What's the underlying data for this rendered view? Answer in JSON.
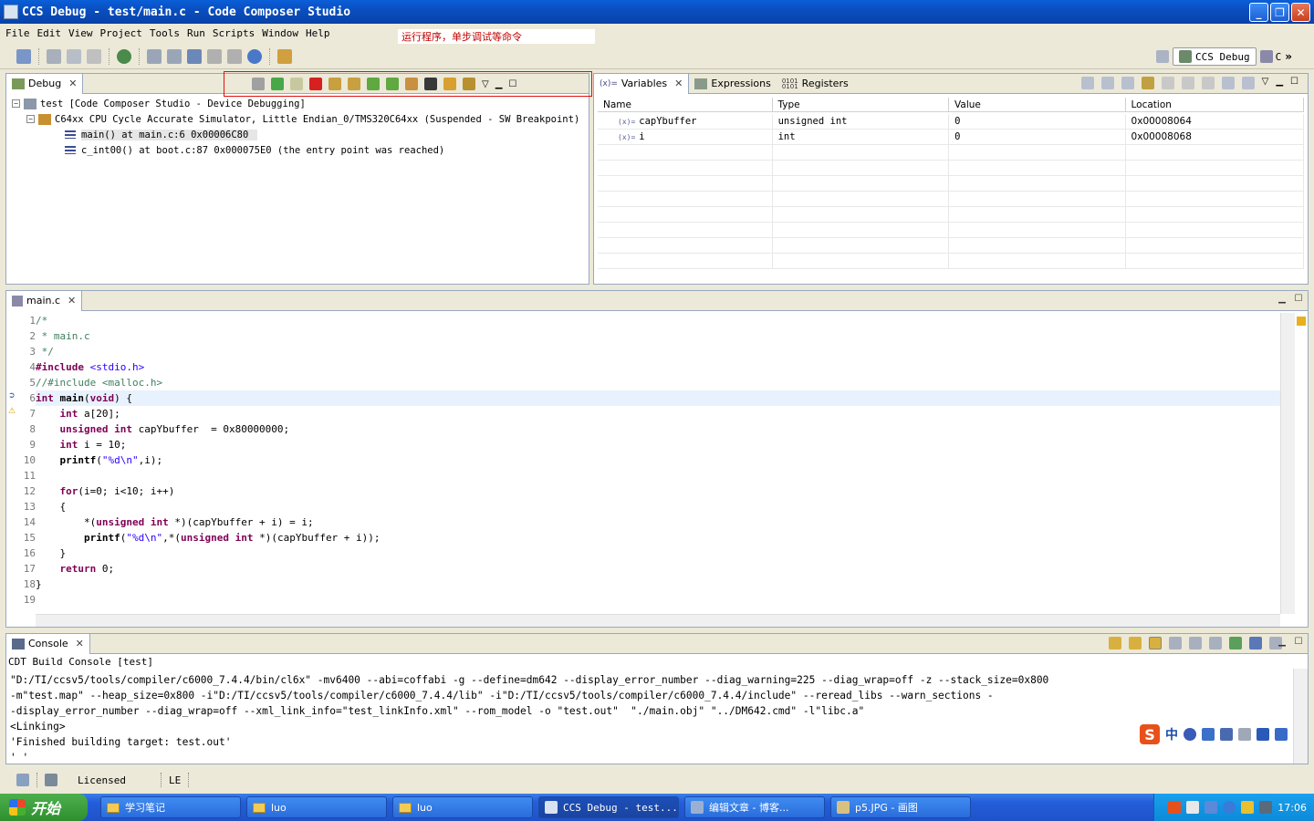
{
  "window": {
    "title": "CCS Debug - test/main.c - Code Composer Studio"
  },
  "menu": [
    "File",
    "Edit",
    "View",
    "Project",
    "Tools",
    "Run",
    "Scripts",
    "Window",
    "Help"
  ],
  "annotation": "运行程序，单步调试等命令",
  "perspective": {
    "active": "CCS Debug",
    "other": "C",
    "more": "»"
  },
  "debug_view": {
    "tab": "Debug",
    "tree": [
      "test [Code Composer Studio - Device Debugging]",
      "C64xx CPU Cycle Accurate Simulator, Little Endian_0/TMS320C64xx (Suspended - SW Breakpoint)",
      "main() at main.c:6 0x00006C80",
      "c_int00() at boot.c:87 0x000075E0  (the entry point was reached)"
    ]
  },
  "variables_view": {
    "tabs": [
      "Variables",
      "Expressions",
      "Registers"
    ],
    "columns": [
      "Name",
      "Type",
      "Value",
      "Location"
    ],
    "rows": [
      {
        "name": "capYbuffer",
        "type": "unsigned int",
        "value": "0",
        "location": "0x00008064"
      },
      {
        "name": "i",
        "type": "int",
        "value": "0",
        "location": "0x00008068"
      }
    ]
  },
  "editor": {
    "tab": "main.c",
    "line_numbers": [
      "1",
      "2",
      "3",
      "4",
      "5",
      "6",
      "7",
      "8",
      "9",
      "10",
      "11",
      "12",
      "13",
      "14",
      "15",
      "16",
      "17",
      "18",
      "19"
    ]
  },
  "console": {
    "tab": "Console",
    "title": "CDT Build Console [test]",
    "lines": [
      "\"D:/TI/ccsv5/tools/compiler/c6000_7.4.4/bin/cl6x\" -mv6400 --abi=coffabi -g --define=dm642 --display_error_number --diag_warning=225 --diag_wrap=off -z --stack_size=0x800",
      "-m\"test.map\" --heap_size=0x800 -i\"D:/TI/ccsv5/tools/compiler/c6000_7.4.4/lib\" -i\"D:/TI/ccsv5/tools/compiler/c6000_7.4.4/include\" --reread_libs --warn_sections -",
      "-display_error_number --diag_wrap=off --xml_link_info=\"test_linkInfo.xml\" --rom_model -o \"test.out\"  \"./main.obj\" \"../DM642.cmd\" -l\"libc.a\"",
      "<Linking>",
      "'Finished building target: test.out'",
      "' '"
    ]
  },
  "ime": {
    "logo": "S",
    "mode": "中"
  },
  "status": {
    "licensed": "Licensed",
    "endian": "LE"
  },
  "taskbar": {
    "start": "开始",
    "tasks": [
      "学习笔记",
      "luo",
      "luo",
      "CCS Debug - test...",
      "编辑文章 - 博客...",
      "p5.JPG - 画图"
    ],
    "clock": "17:06"
  },
  "colors": {
    "accent": "#0a4fc0",
    "keyword": "#7f0055",
    "comment": "#3f7f5f",
    "string": "#2a00ff",
    "highlight_box": "#e01010"
  }
}
